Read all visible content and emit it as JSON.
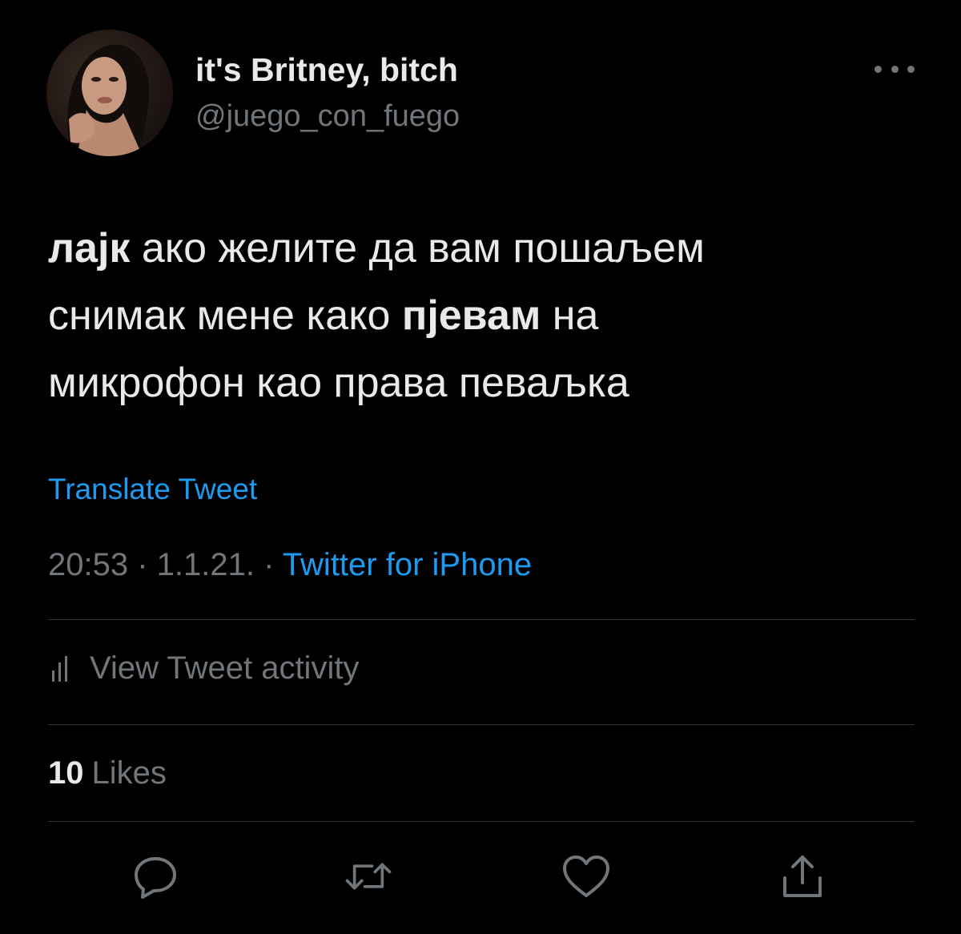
{
  "author": {
    "display_name": "it's Britney, bitch",
    "handle": "@juego_con_fuego",
    "avatar_icon": "profile-photo"
  },
  "more_icon": "more-horizontal-icon",
  "tweet": {
    "line1": {
      "bold": "лајк",
      "rest": " ако желите да вам пошаљем"
    },
    "line2": {
      "before": "снимак мене како ",
      "bold": "пјевам",
      "after": " на"
    },
    "line3": "микрофон као права певаљка"
  },
  "translate_label": "Translate Tweet",
  "meta": {
    "time": "20:53",
    "separator": " · ",
    "date": "1.1.21.",
    "source": "Twitter for iPhone"
  },
  "activity_label": "View Tweet activity",
  "likes": {
    "count": "10",
    "label": "Likes"
  },
  "actions": [
    {
      "icon": "reply-icon"
    },
    {
      "icon": "retweet-icon"
    },
    {
      "icon": "like-icon"
    },
    {
      "icon": "share-icon"
    }
  ],
  "colors": {
    "background": "#000000",
    "text": "#e7e9ea",
    "secondary": "#71767b",
    "accent": "#1d9bf0",
    "divider": "#2f3336"
  }
}
